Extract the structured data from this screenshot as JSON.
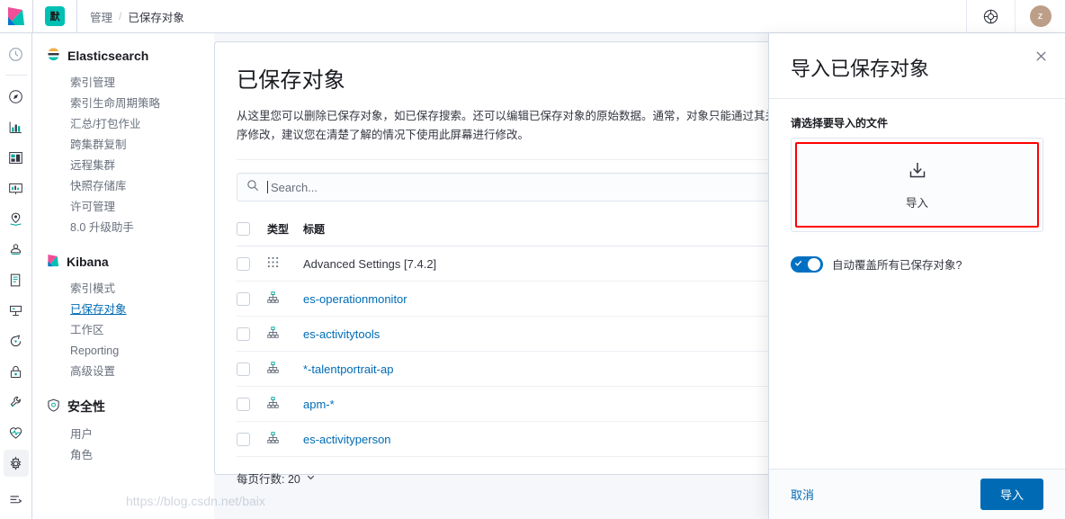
{
  "header": {
    "logo_icon": "kibana-logo-icon",
    "space_badge": "默",
    "breadcrumbs": [
      {
        "label": "管理"
      },
      {
        "label": "已保存对象"
      }
    ],
    "breadcrumb_separator": "/",
    "help_icon": "help-lifebuoy-icon",
    "avatar_initial": "z"
  },
  "rail": {
    "items": [
      {
        "name": "recently-viewed",
        "icon": "clock-icon"
      },
      {
        "name": "discover",
        "icon": "compass-icon"
      },
      {
        "name": "visualize",
        "icon": "bar-chart-icon"
      },
      {
        "name": "dashboard",
        "icon": "dashboard-icon"
      },
      {
        "name": "canvas",
        "icon": "canvas-icon"
      },
      {
        "name": "maps",
        "icon": "map-pin-icon"
      },
      {
        "name": "machine-learning",
        "icon": "ml-icon"
      },
      {
        "name": "logs",
        "icon": "logs-icon"
      },
      {
        "name": "apm",
        "icon": "apm-icon"
      },
      {
        "name": "uptime",
        "icon": "uptime-icon"
      },
      {
        "name": "siem",
        "icon": "lock-icon"
      },
      {
        "name": "dev-tools",
        "icon": "wrench-icon"
      },
      {
        "name": "monitoring",
        "icon": "heartbeat-icon"
      },
      {
        "name": "management",
        "icon": "gear-icon"
      },
      {
        "name": "collapse",
        "icon": "arrow-right-icon"
      }
    ]
  },
  "nav": {
    "groups": [
      {
        "title": "Elasticsearch",
        "icon": "elasticsearch-logo-icon",
        "items": [
          {
            "label": "索引管理",
            "active": false
          },
          {
            "label": "索引生命周期策略",
            "active": false
          },
          {
            "label": "汇总/打包作业",
            "active": false
          },
          {
            "label": "跨集群复制",
            "active": false
          },
          {
            "label": "远程集群",
            "active": false
          },
          {
            "label": "快照存储库",
            "active": false
          },
          {
            "label": "许可管理",
            "active": false
          },
          {
            "label": "8.0 升级助手",
            "active": false
          }
        ]
      },
      {
        "title": "Kibana",
        "icon": "kibana-logo-icon",
        "items": [
          {
            "label": "索引模式",
            "active": false
          },
          {
            "label": "已保存对象",
            "active": true
          },
          {
            "label": "工作区",
            "active": false
          },
          {
            "label": "Reporting",
            "active": false
          },
          {
            "label": "高级设置",
            "active": false
          }
        ]
      },
      {
        "title": "安全性",
        "icon": "shield-icon",
        "items": [
          {
            "label": "用户",
            "active": false
          },
          {
            "label": "角色",
            "active": false
          }
        ]
      }
    ]
  },
  "main": {
    "title": "已保存对象",
    "description": "从这里您可以删除已保存对象，如已保存搜索。还可以编辑已保存对象的原始数据。通常，对象只能通过其关联应用程序修改，建议您在清楚了解的情况下使用此屏幕进行修改。",
    "search": {
      "placeholder": "Search...",
      "value": "",
      "icon": "search-icon"
    },
    "table": {
      "columns": [
        "类型",
        "标题"
      ],
      "rows": [
        {
          "icon": "advanced-settings-grid-icon",
          "title": "Advanced Settings [7.4.2]",
          "is_link": false
        },
        {
          "icon": "index-pattern-icon",
          "title": "es-operationmonitor",
          "is_link": true
        },
        {
          "icon": "index-pattern-icon",
          "title": "es-activitytools",
          "is_link": true
        },
        {
          "icon": "index-pattern-icon",
          "title": "*-talentportrait-ap",
          "is_link": true
        },
        {
          "icon": "index-pattern-icon",
          "title": "apm-*",
          "is_link": true
        },
        {
          "icon": "index-pattern-icon",
          "title": "es-activityperson",
          "is_link": true
        }
      ]
    },
    "rows_per_page_label": "每页行数: 20"
  },
  "flyout": {
    "title": "导入已保存对象",
    "close_icon": "close-icon",
    "file_label": "请选择要导入的文件",
    "dropzone": {
      "icon": "import-icon",
      "label": "导入",
      "highlight_color": "#ff0000"
    },
    "overwrite_toggle": {
      "label": "自动覆盖所有已保存对象?",
      "checked": true,
      "color": "#0071c2"
    },
    "cancel_label": "取消",
    "import_label": "导入",
    "primary_color": "#006bb4"
  },
  "watermark": "https://blog.csdn.net/baix"
}
